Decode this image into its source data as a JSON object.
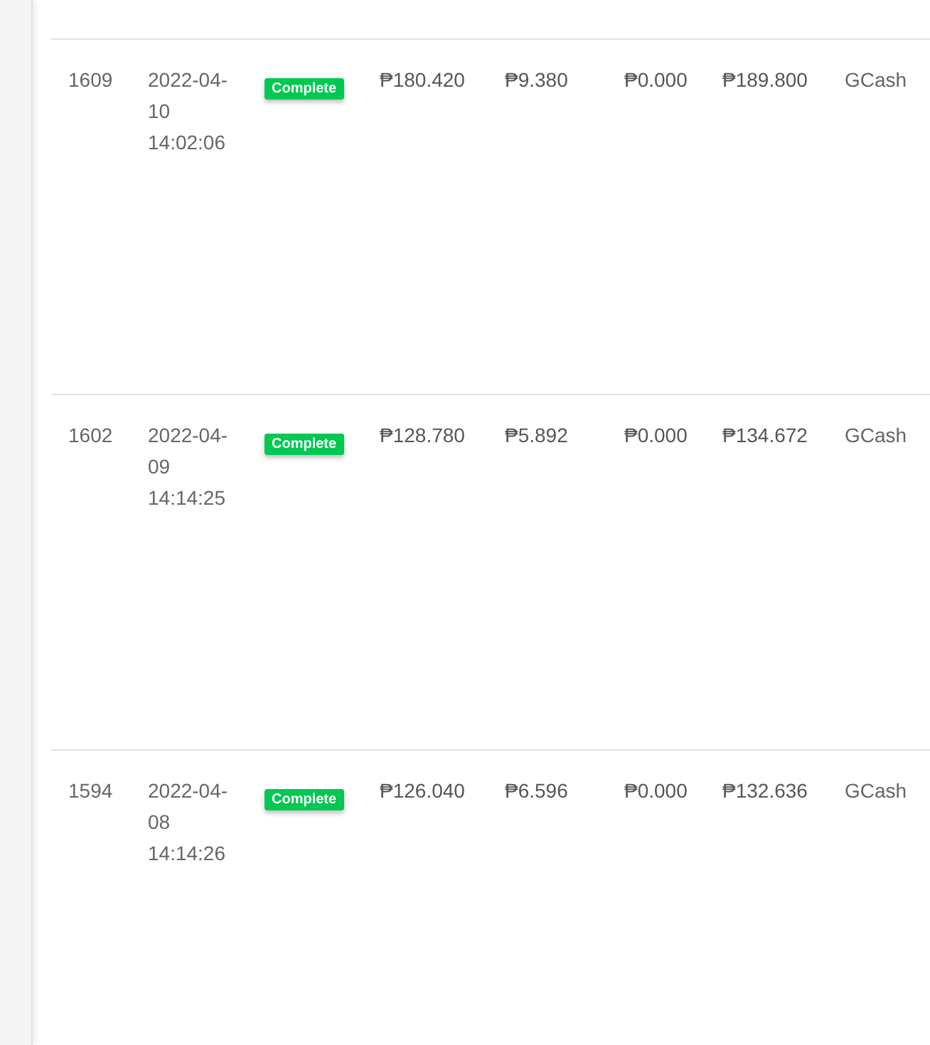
{
  "orders": [
    {
      "id": "1609",
      "datetime": "2022-04-10 14:02:06",
      "status": {
        "label": "Complete",
        "kind": "complete"
      },
      "subtotal": "₱180.420",
      "fee": "₱9.380",
      "discount": "₱0.000",
      "total": "₱189.800",
      "payment_method": "GCash"
    },
    {
      "id": "1602",
      "datetime": "2022-04-09 14:14:25",
      "status": {
        "label": "Complete",
        "kind": "complete"
      },
      "subtotal": "₱128.780",
      "fee": "₱5.892",
      "discount": "₱0.000",
      "total": "₱134.672",
      "payment_method": "GCash"
    },
    {
      "id": "1594",
      "datetime": "2022-04-08 14:14:26",
      "status": {
        "label": "Complete",
        "kind": "complete"
      },
      "subtotal": "₱126.040",
      "fee": "₱6.596",
      "discount": "₱0.000",
      "total": "₱132.636",
      "payment_method": "GCash"
    }
  ]
}
